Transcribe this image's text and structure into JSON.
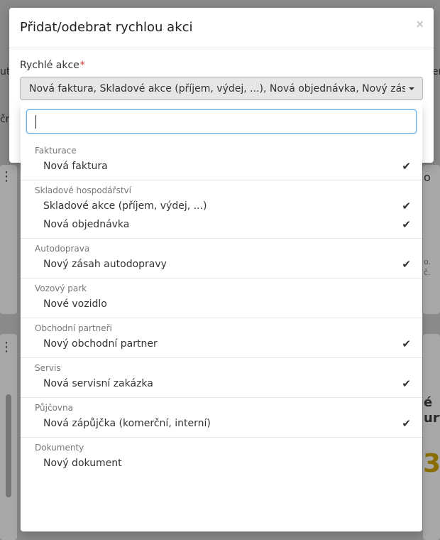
{
  "modal": {
    "title": "Přidat/odebrat rychlou akci",
    "close_icon": "×",
    "field_label": "Rychlé akce",
    "required_mark": "*",
    "selected_value": "Nová faktura, Skladové akce (příjem, výdej, ...), Nová objednávka, Nový zásah autodopravy, Nový obchodní partner, Nová servisní zakázka, Nová zápůjčka (komerční, interní)"
  },
  "dropdown": {
    "search_value": "",
    "groups": [
      {
        "label": "Fakturace",
        "options": [
          {
            "label": "Nová faktura",
            "checked": true
          }
        ]
      },
      {
        "label": "Skladové hospodářství",
        "options": [
          {
            "label": "Skladové akce (příjem, výdej, ...)",
            "checked": true
          },
          {
            "label": "Nová objednávka",
            "checked": true
          }
        ]
      },
      {
        "label": "Autodoprava",
        "options": [
          {
            "label": "Nový zásah autodopravy",
            "checked": true
          }
        ]
      },
      {
        "label": "Vozový park",
        "options": [
          {
            "label": "Nové vozidlo",
            "checked": false
          }
        ]
      },
      {
        "label": "Obchodní partneři",
        "options": [
          {
            "label": "Nový obchodní partner",
            "checked": true
          }
        ]
      },
      {
        "label": "Servis",
        "options": [
          {
            "label": "Nová servisní zakázka",
            "checked": true
          }
        ]
      },
      {
        "label": "Půjčovna",
        "options": [
          {
            "label": "Nová zápůjčka (komerční, interní)",
            "checked": true
          }
        ]
      },
      {
        "label": "Dokumenty",
        "options": [
          {
            "label": "Nový dokument",
            "checked": false
          }
        ]
      }
    ],
    "check_icon": "✔"
  },
  "background": {
    "left_fragment_1": "ut",
    "left_fragment_2": "čn",
    "right_fragment_1": "er",
    "right_fragment_2": "o",
    "right_fragment_3": "é",
    "right_fragment_4": "ury",
    "right_small_1": "o.",
    "right_small_2": "č.",
    "big_number": "3"
  }
}
